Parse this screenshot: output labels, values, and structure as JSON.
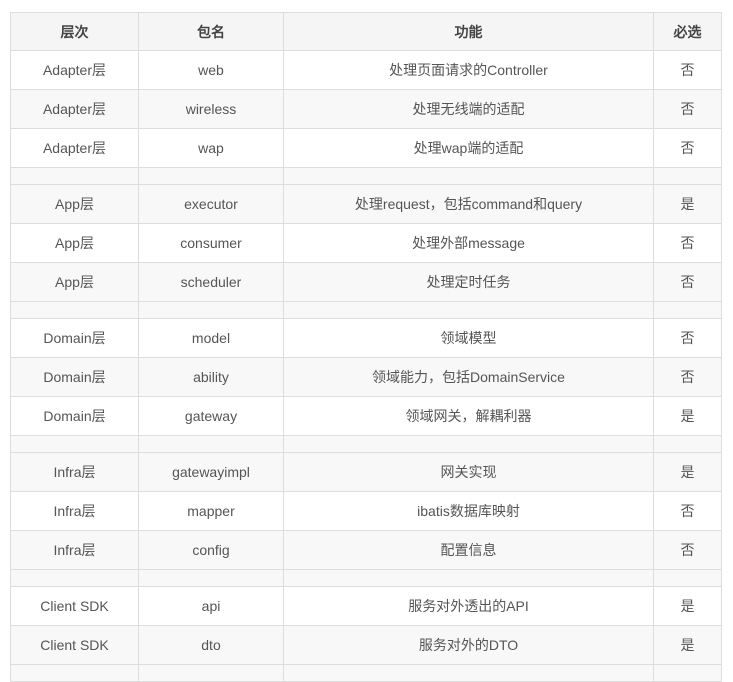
{
  "table": {
    "headers": [
      "层次",
      "包名",
      "功能",
      "必选"
    ],
    "rows": [
      {
        "type": "data",
        "cells": [
          "Adapter层",
          "web",
          "处理页面请求的Controller",
          "否"
        ]
      },
      {
        "type": "data",
        "cells": [
          "Adapter层",
          "wireless",
          "处理无线端的适配",
          "否"
        ]
      },
      {
        "type": "data",
        "cells": [
          "Adapter层",
          "wap",
          "处理wap端的适配",
          "否"
        ]
      },
      {
        "type": "spacer"
      },
      {
        "type": "data",
        "cells": [
          "App层",
          "executor",
          "处理request，包括command和query",
          "是"
        ]
      },
      {
        "type": "data",
        "cells": [
          "App层",
          "consumer",
          "处理外部message",
          "否"
        ]
      },
      {
        "type": "data",
        "cells": [
          "App层",
          "scheduler",
          "处理定时任务",
          "否"
        ]
      },
      {
        "type": "spacer"
      },
      {
        "type": "data",
        "cells": [
          "Domain层",
          "model",
          "领域模型",
          "否"
        ]
      },
      {
        "type": "data",
        "cells": [
          "Domain层",
          "ability",
          "领域能力，包括DomainService",
          "否"
        ]
      },
      {
        "type": "data",
        "cells": [
          "Domain层",
          "gateway",
          "领域网关，解耦利器",
          "是"
        ]
      },
      {
        "type": "spacer"
      },
      {
        "type": "data",
        "cells": [
          "Infra层",
          "gatewayimpl",
          "网关实现",
          "是"
        ]
      },
      {
        "type": "data",
        "cells": [
          "Infra层",
          "mapper",
          "ibatis数据库映射",
          "否"
        ]
      },
      {
        "type": "data",
        "cells": [
          "Infra层",
          "config",
          "配置信息",
          "否"
        ]
      },
      {
        "type": "spacer"
      },
      {
        "type": "data",
        "cells": [
          "Client SDK",
          "api",
          "服务对外透出的API",
          "是"
        ]
      },
      {
        "type": "data",
        "cells": [
          "Client SDK",
          "dto",
          "服务对外的DTO",
          "是"
        ]
      },
      {
        "type": "spacer"
      }
    ]
  }
}
